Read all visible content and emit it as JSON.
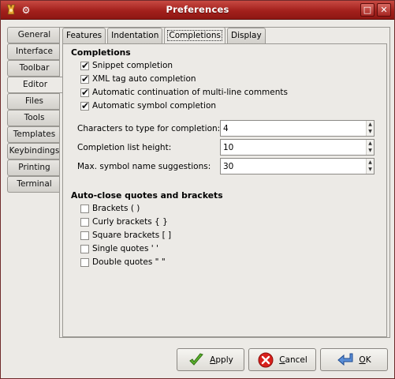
{
  "window": {
    "title": "Preferences",
    "maximize_glyph": "□",
    "close_glyph": "✕",
    "menu_glyph": "⚙"
  },
  "sidebar": {
    "items": [
      {
        "label": "General"
      },
      {
        "label": "Interface"
      },
      {
        "label": "Toolbar"
      },
      {
        "label": "Editor",
        "active": true
      },
      {
        "label": "Files"
      },
      {
        "label": "Tools"
      },
      {
        "label": "Templates"
      },
      {
        "label": "Keybindings"
      },
      {
        "label": "Printing"
      },
      {
        "label": "Terminal"
      }
    ]
  },
  "tabs": {
    "items": [
      {
        "label": "Features"
      },
      {
        "label": "Indentation"
      },
      {
        "label": "Completions",
        "active": true
      },
      {
        "label": "Display"
      }
    ]
  },
  "completions": {
    "title": "Completions",
    "checkboxes": [
      {
        "label": "Snippet completion",
        "checked": true
      },
      {
        "label": "XML tag auto completion",
        "checked": true
      },
      {
        "label": "Automatic continuation of multi-line comments",
        "checked": true
      },
      {
        "label": "Automatic symbol completion",
        "checked": true
      }
    ],
    "fields": [
      {
        "label": "Characters to type for completion:",
        "value": "4"
      },
      {
        "label": "Completion list height:",
        "value": "10"
      },
      {
        "label": "Max. symbol name suggestions:",
        "value": "30"
      }
    ]
  },
  "autoclose": {
    "title": "Auto-close quotes and brackets",
    "checkboxes": [
      {
        "label": "Brackets ( )",
        "checked": false
      },
      {
        "label": "Curly brackets { }",
        "checked": false
      },
      {
        "label": "Square brackets [ ]",
        "checked": false
      },
      {
        "label": "Single quotes ' '",
        "checked": false
      },
      {
        "label": "Double quotes \" \"",
        "checked": false
      }
    ]
  },
  "buttons": {
    "apply": {
      "pre": "",
      "u": "A",
      "post": "pply",
      "icon": "checkmark-icon"
    },
    "cancel": {
      "pre": "",
      "u": "C",
      "post": "ancel",
      "icon": "cancel-icon"
    },
    "ok": {
      "pre": "",
      "u": "O",
      "post": "K",
      "icon": "return-arrow-icon"
    }
  },
  "colors": {
    "titlebar": "#a3201c",
    "window_bg": "#eceae6",
    "apply_icon": "#5db32f",
    "cancel_icon": "#d8201c",
    "ok_icon": "#3f6fbf"
  }
}
